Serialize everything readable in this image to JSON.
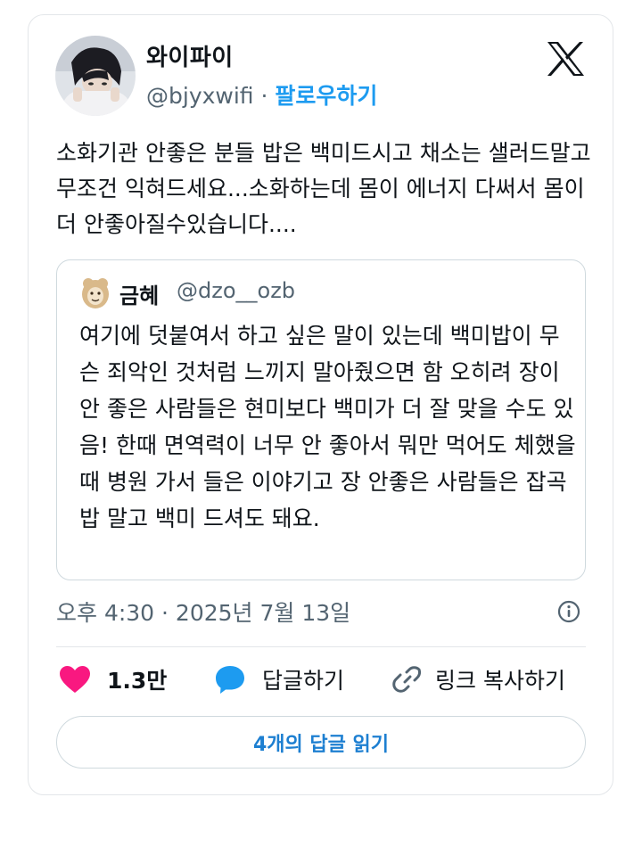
{
  "tweet": {
    "display_name": "와이파이",
    "handle": "@bjyxwifi",
    "separator": "·",
    "follow_label": "팔로우하기",
    "text": "소화기관 안좋은 분들 밥은 백미드시고 채소는 샐러드말고 무조건 익혀드세요...소화하는데 몸이 에너지 다써서 몸이 더 안좋아질수있습니다....",
    "timestamp": "오후 4:30 · 2025년 7월 13일"
  },
  "quote": {
    "display_name": "금혜",
    "handle": "@dzo__ozb",
    "text": "여기에 덧붙여서 하고 싶은 말이 있는데 백미밥이 무슨 죄악인 것처럼 느끼지 말아줬으면 함 오히려 장이 안 좋은 사람들은 현미보다 백미가 더 잘 맞을 수도 있음! 한때 면역력이 너무 안 좋아서 뭐만 먹어도 체했을 때 병원 가서 들은 이야기고 장 안좋은 사람들은 잡곡밥 말고 백미 드셔도 돼요."
  },
  "actions": {
    "like_count": "1.3만",
    "reply_label": "답글하기",
    "copy_link_label": "링크 복사하기",
    "read_replies_label": "4개의 답글 읽기"
  },
  "icons": {
    "brand": "x-logo-icon",
    "info": "info-icon",
    "like": "heart-icon",
    "reply": "speech-bubble-icon",
    "link": "link-icon"
  },
  "colors": {
    "accent": "#1d9bf0",
    "like": "#f91880",
    "muted_text": "#536471",
    "border": "#cfd9de"
  }
}
